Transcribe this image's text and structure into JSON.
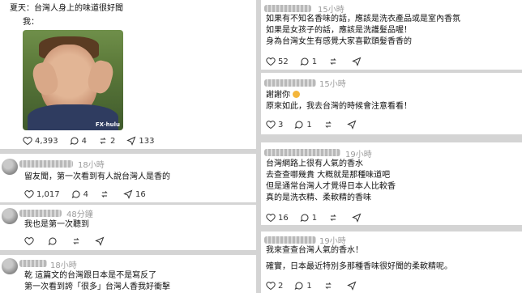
{
  "left_top": {
    "header": "夏天：台灣人身上的味道很好聞",
    "me_label": "我：",
    "photo_watermark": "FX∙hulu",
    "actions": {
      "likes": "4,393",
      "replies": "4",
      "reposts": "2",
      "shares": "133"
    }
  },
  "left_c1": {
    "time": "18小時",
    "text": "留友聞，第一次看到有人說台灣人是香的",
    "actions": {
      "likes": "1,017",
      "replies": "4",
      "reposts": "",
      "shares": "16"
    }
  },
  "left_c2": {
    "time": "48分鐘",
    "text": "我也是第一次聽到",
    "actions": {
      "likes": "",
      "replies": "",
      "reposts": "",
      "shares": ""
    }
  },
  "left_c3": {
    "time": "18小時",
    "line1": "乾 這篇文的台灣跟日本是不是寫反了",
    "line2": "第一次看到誇「很多」台灣人香我好衝擊"
  },
  "right_p1": {
    "time": "15小時",
    "line1": "如果有不知名香味的話，應該是洗衣產品或是室內香氛",
    "line2": "如果是女孩子的話，應該是洗護髮品喔！",
    "line3": "身為台灣女生有感覺大家喜歡頭髮香香的",
    "actions": {
      "likes": "52",
      "replies": "1",
      "reposts": "",
      "shares": ""
    }
  },
  "right_p2": {
    "time": "15小時",
    "line1": "謝謝你",
    "line2": "原來如此，我去台灣的時候會注意看看！",
    "actions": {
      "likes": "3",
      "replies": "1",
      "reposts": "",
      "shares": ""
    }
  },
  "right_p3": {
    "time": "19小時",
    "line1": "台灣網路上很有人氣的香水",
    "line2": "去查查哪幾貴 大概就是那種味道吧",
    "line3": "但是通常台灣人才覺得日本人比較香",
    "line4": "真的是洗衣精、柔軟精的香味",
    "actions": {
      "likes": "16",
      "replies": "1",
      "reposts": "",
      "shares": ""
    }
  },
  "right_p4": {
    "time": "19小時",
    "line1": "我來查查台灣人氣的香水！",
    "line2": "確實，日本最近特別多那種香味很好聞的柔軟精呢。",
    "actions": {
      "likes": "2",
      "replies": "1",
      "reposts": "",
      "shares": ""
    }
  }
}
